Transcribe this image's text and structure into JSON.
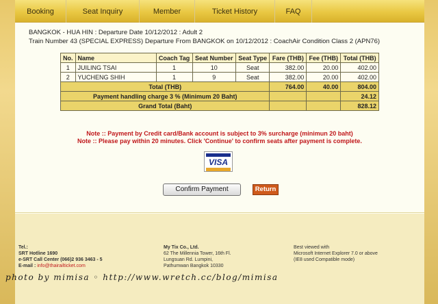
{
  "nav": {
    "items": [
      "Booking",
      "Seat Inquiry",
      "Member",
      "Ticket History",
      "FAQ"
    ]
  },
  "info": {
    "line1": "BANGKOK - HUA HIN : Departure Date 10/12/2012 : Adult 2",
    "line2": "Train Number 43 (SPECIAL EXPRESS) Departure From BANGKOK on 10/12/2012 : CoachAir Condition Class 2 (APN76)"
  },
  "table": {
    "headers": [
      "No.",
      "Name",
      "Coach Tag",
      "Seat Number",
      "Seat Type",
      "Fare (THB)",
      "Fee (THB)",
      "Total (THB)"
    ],
    "rows": [
      [
        "1",
        "JUILING TSAI",
        "1",
        "10",
        "Seat",
        "382.00",
        "20.00",
        "402.00"
      ],
      [
        "2",
        "YUCHENG SHIH",
        "1",
        "9",
        "Seat",
        "382.00",
        "20.00",
        "402.00"
      ]
    ],
    "total": {
      "label": "Total (THB)",
      "fare": "764.00",
      "fee": "40.00",
      "total": "804.00"
    },
    "handling": {
      "label": "Payment handling charge 3 % (Minimum 20 Baht)",
      "value": "24.12"
    },
    "grand": {
      "label": "Grand Total (Baht)",
      "value": "828.12"
    }
  },
  "notes": {
    "n1": "Note :: Payment by Credit card/Bank account is subject to 3% surcharge (minimun 20 baht)",
    "n2": "Note :: Please pay within 20 minutes. Click 'Continue' to confirm seats after payment is complete."
  },
  "visa": {
    "label": "VISA"
  },
  "buttons": {
    "confirm": "Confirm Payment",
    "return": "Return"
  },
  "footer": {
    "col1": {
      "tel": "Tel.:",
      "hotline": "SRT Hotline 1690",
      "call": "e-SRT Call Center (066)2 936 3463 - 5",
      "email_label": "E-mail :",
      "email": "info@thairailticket.com"
    },
    "col2": {
      "company": "My Tix Co., Ltd.",
      "addr1": "62 The Millennia Tower, 16th Fl.",
      "addr2": "Lungsuan Rd. Lumpini,",
      "addr3": "Pathumwan Bangkok 10330"
    },
    "col3": {
      "line1": "Best viewed with",
      "line2": "Microsoft Internet Explorer 7.0 or above",
      "line3": "(IE8 used Compatible mode)"
    }
  },
  "watermark": "photo by mimisa ◦ http://www.wretch.cc/blog/mimisa"
}
